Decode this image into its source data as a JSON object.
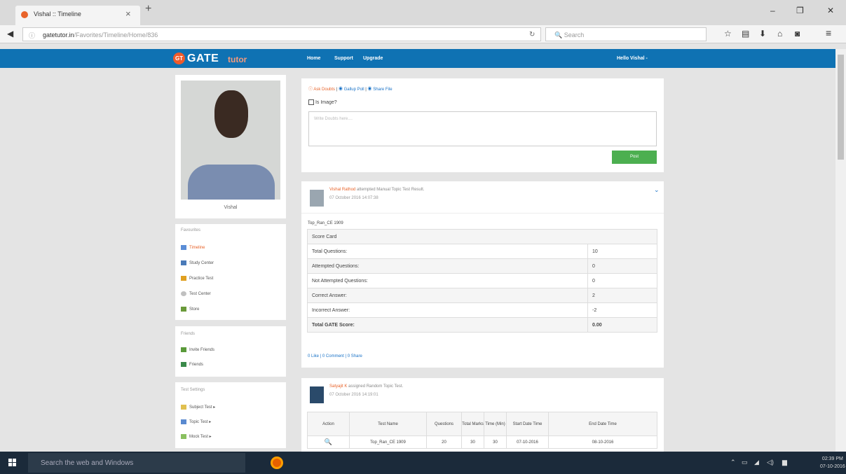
{
  "browser": {
    "tab_title": "Vishal :: Timeline",
    "url_domain": "gatetutor.in",
    "url_path": "/Favorites/Timeline/Home/836",
    "search_placeholder": "Search"
  },
  "header": {
    "logo_badge": "GT",
    "logo_main": "GATE",
    "logo_sub": "tutor",
    "nav": [
      "Home",
      "Support",
      "Upgrade"
    ],
    "greeting": "Hello Vishal -"
  },
  "profile": {
    "name": "Vishal"
  },
  "sidebar": {
    "favourites_title": "Favourites",
    "favourites": [
      "Timeline",
      "Study Center",
      "Practice Test",
      "Test Center",
      "Store"
    ],
    "friends_title": "Friends",
    "friends": [
      "Invite Friends",
      "Friends"
    ],
    "settings_title": "Test Settings",
    "settings": [
      "Subject Test ▸",
      "Topic Test ▸",
      "Mock Test ▸"
    ]
  },
  "composer": {
    "ask_doubts": "Ask Doubts",
    "gallup_poll": "Gallup Poll",
    "share_file": "Share File",
    "sep": "|",
    "is_image": "Is Image?",
    "placeholder": "Write Doubts here....",
    "post": "Post"
  },
  "post1": {
    "author": "Vishal Rathod",
    "action": "attempted Manual Topic Test Result.",
    "time": "07 October 2016 14:07:38",
    "test_name": "Top_Ran_CE 1909",
    "score_card_title": "Score Card",
    "rows": [
      {
        "label": "Total Questions:",
        "value": "10"
      },
      {
        "label": "Attempted Questions:",
        "value": "0"
      },
      {
        "label": "Not Attempted Questions:",
        "value": "0"
      },
      {
        "label": "Correct Answer:",
        "value": "2"
      },
      {
        "label": "Incorrect Answer:",
        "value": "-2"
      },
      {
        "label": "Total GATE Score:",
        "value": "0.00"
      }
    ],
    "social": "0 Like | 0 Comment | 0 Share"
  },
  "post2": {
    "author": "Satyajit K",
    "action": "assigned Random Topic Test.",
    "time": "07 October 2016 14:19:01",
    "headers": [
      "Action",
      "Test Name",
      "Questions",
      "Total Marks",
      "Time (Min)",
      "Start Date Time",
      "End Date Time"
    ],
    "row": [
      "Top_Ran_CE 1909",
      "20",
      "30",
      "30",
      "07-10-2016",
      "08-10-2016"
    ]
  },
  "taskbar": {
    "search_placeholder": "Search the web and Windows",
    "time": "02:39 PM",
    "date": "07-10-2016"
  }
}
